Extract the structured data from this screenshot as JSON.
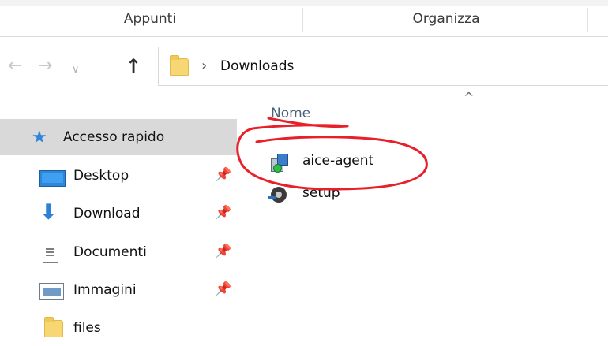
{
  "ribbon": {
    "groups": [
      "Appunti",
      "Organizza"
    ]
  },
  "navigation": {
    "back_icon": "arrow-left-icon",
    "forward_icon": "arrow-right-icon",
    "recent_icon": "chevron-down-icon",
    "up_icon": "arrow-up-icon",
    "breadcrumb": {
      "current": "Downloads"
    }
  },
  "navpane": {
    "items": [
      {
        "label": "Accesso rapido",
        "icon": "star-icon",
        "pinned": false,
        "selected": true
      },
      {
        "label": "Desktop",
        "icon": "desktop-icon",
        "pinned": true
      },
      {
        "label": "Download",
        "icon": "download-icon",
        "pinned": true
      },
      {
        "label": "Documenti",
        "icon": "documents-icon",
        "pinned": true
      },
      {
        "label": "Immagini",
        "icon": "pictures-icon",
        "pinned": true
      },
      {
        "label": "files",
        "icon": "folder-icon",
        "pinned": false
      }
    ]
  },
  "content": {
    "column_header": "Nome",
    "sort_indicator": "sort-ascending-icon",
    "files": [
      {
        "name": "aice-agent",
        "icon": "installer-icon",
        "highlighted": true
      },
      {
        "name": "setup",
        "icon": "setup-icon",
        "highlighted": false
      }
    ]
  },
  "colors": {
    "selection": "#d9d9d9",
    "annotation": "#e8202a",
    "header_text": "#4c607a"
  }
}
